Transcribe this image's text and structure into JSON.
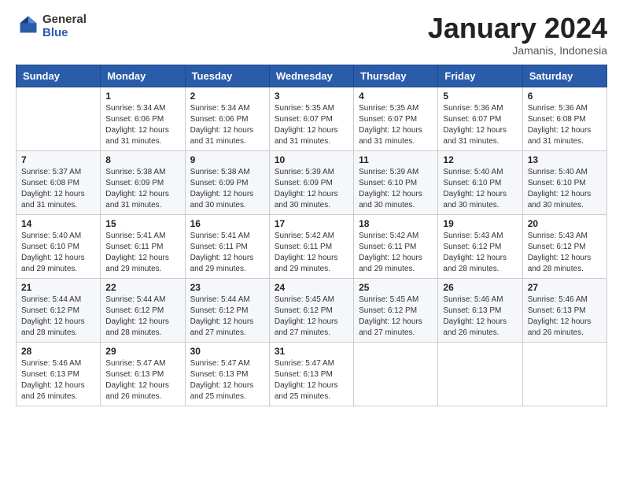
{
  "header": {
    "logo_general": "General",
    "logo_blue": "Blue",
    "month_title": "January 2024",
    "subtitle": "Jamanis, Indonesia"
  },
  "weekdays": [
    "Sunday",
    "Monday",
    "Tuesday",
    "Wednesday",
    "Thursday",
    "Friday",
    "Saturday"
  ],
  "weeks": [
    [
      {
        "day": "",
        "sunrise": "",
        "sunset": "",
        "daylight": ""
      },
      {
        "day": "1",
        "sunrise": "Sunrise: 5:34 AM",
        "sunset": "Sunset: 6:06 PM",
        "daylight": "Daylight: 12 hours and 31 minutes."
      },
      {
        "day": "2",
        "sunrise": "Sunrise: 5:34 AM",
        "sunset": "Sunset: 6:06 PM",
        "daylight": "Daylight: 12 hours and 31 minutes."
      },
      {
        "day": "3",
        "sunrise": "Sunrise: 5:35 AM",
        "sunset": "Sunset: 6:07 PM",
        "daylight": "Daylight: 12 hours and 31 minutes."
      },
      {
        "day": "4",
        "sunrise": "Sunrise: 5:35 AM",
        "sunset": "Sunset: 6:07 PM",
        "daylight": "Daylight: 12 hours and 31 minutes."
      },
      {
        "day": "5",
        "sunrise": "Sunrise: 5:36 AM",
        "sunset": "Sunset: 6:07 PM",
        "daylight": "Daylight: 12 hours and 31 minutes."
      },
      {
        "day": "6",
        "sunrise": "Sunrise: 5:36 AM",
        "sunset": "Sunset: 6:08 PM",
        "daylight": "Daylight: 12 hours and 31 minutes."
      }
    ],
    [
      {
        "day": "7",
        "sunrise": "Sunrise: 5:37 AM",
        "sunset": "Sunset: 6:08 PM",
        "daylight": "Daylight: 12 hours and 31 minutes."
      },
      {
        "day": "8",
        "sunrise": "Sunrise: 5:38 AM",
        "sunset": "Sunset: 6:09 PM",
        "daylight": "Daylight: 12 hours and 31 minutes."
      },
      {
        "day": "9",
        "sunrise": "Sunrise: 5:38 AM",
        "sunset": "Sunset: 6:09 PM",
        "daylight": "Daylight: 12 hours and 30 minutes."
      },
      {
        "day": "10",
        "sunrise": "Sunrise: 5:39 AM",
        "sunset": "Sunset: 6:09 PM",
        "daylight": "Daylight: 12 hours and 30 minutes."
      },
      {
        "day": "11",
        "sunrise": "Sunrise: 5:39 AM",
        "sunset": "Sunset: 6:10 PM",
        "daylight": "Daylight: 12 hours and 30 minutes."
      },
      {
        "day": "12",
        "sunrise": "Sunrise: 5:40 AM",
        "sunset": "Sunset: 6:10 PM",
        "daylight": "Daylight: 12 hours and 30 minutes."
      },
      {
        "day": "13",
        "sunrise": "Sunrise: 5:40 AM",
        "sunset": "Sunset: 6:10 PM",
        "daylight": "Daylight: 12 hours and 30 minutes."
      }
    ],
    [
      {
        "day": "14",
        "sunrise": "Sunrise: 5:40 AM",
        "sunset": "Sunset: 6:10 PM",
        "daylight": "Daylight: 12 hours and 29 minutes."
      },
      {
        "day": "15",
        "sunrise": "Sunrise: 5:41 AM",
        "sunset": "Sunset: 6:11 PM",
        "daylight": "Daylight: 12 hours and 29 minutes."
      },
      {
        "day": "16",
        "sunrise": "Sunrise: 5:41 AM",
        "sunset": "Sunset: 6:11 PM",
        "daylight": "Daylight: 12 hours and 29 minutes."
      },
      {
        "day": "17",
        "sunrise": "Sunrise: 5:42 AM",
        "sunset": "Sunset: 6:11 PM",
        "daylight": "Daylight: 12 hours and 29 minutes."
      },
      {
        "day": "18",
        "sunrise": "Sunrise: 5:42 AM",
        "sunset": "Sunset: 6:11 PM",
        "daylight": "Daylight: 12 hours and 29 minutes."
      },
      {
        "day": "19",
        "sunrise": "Sunrise: 5:43 AM",
        "sunset": "Sunset: 6:12 PM",
        "daylight": "Daylight: 12 hours and 28 minutes."
      },
      {
        "day": "20",
        "sunrise": "Sunrise: 5:43 AM",
        "sunset": "Sunset: 6:12 PM",
        "daylight": "Daylight: 12 hours and 28 minutes."
      }
    ],
    [
      {
        "day": "21",
        "sunrise": "Sunrise: 5:44 AM",
        "sunset": "Sunset: 6:12 PM",
        "daylight": "Daylight: 12 hours and 28 minutes."
      },
      {
        "day": "22",
        "sunrise": "Sunrise: 5:44 AM",
        "sunset": "Sunset: 6:12 PM",
        "daylight": "Daylight: 12 hours and 28 minutes."
      },
      {
        "day": "23",
        "sunrise": "Sunrise: 5:44 AM",
        "sunset": "Sunset: 6:12 PM",
        "daylight": "Daylight: 12 hours and 27 minutes."
      },
      {
        "day": "24",
        "sunrise": "Sunrise: 5:45 AM",
        "sunset": "Sunset: 6:12 PM",
        "daylight": "Daylight: 12 hours and 27 minutes."
      },
      {
        "day": "25",
        "sunrise": "Sunrise: 5:45 AM",
        "sunset": "Sunset: 6:12 PM",
        "daylight": "Daylight: 12 hours and 27 minutes."
      },
      {
        "day": "26",
        "sunrise": "Sunrise: 5:46 AM",
        "sunset": "Sunset: 6:13 PM",
        "daylight": "Daylight: 12 hours and 26 minutes."
      },
      {
        "day": "27",
        "sunrise": "Sunrise: 5:46 AM",
        "sunset": "Sunset: 6:13 PM",
        "daylight": "Daylight: 12 hours and 26 minutes."
      }
    ],
    [
      {
        "day": "28",
        "sunrise": "Sunrise: 5:46 AM",
        "sunset": "Sunset: 6:13 PM",
        "daylight": "Daylight: 12 hours and 26 minutes."
      },
      {
        "day": "29",
        "sunrise": "Sunrise: 5:47 AM",
        "sunset": "Sunset: 6:13 PM",
        "daylight": "Daylight: 12 hours and 26 minutes."
      },
      {
        "day": "30",
        "sunrise": "Sunrise: 5:47 AM",
        "sunset": "Sunset: 6:13 PM",
        "daylight": "Daylight: 12 hours and 25 minutes."
      },
      {
        "day": "31",
        "sunrise": "Sunrise: 5:47 AM",
        "sunset": "Sunset: 6:13 PM",
        "daylight": "Daylight: 12 hours and 25 minutes."
      },
      {
        "day": "",
        "sunrise": "",
        "sunset": "",
        "daylight": ""
      },
      {
        "day": "",
        "sunrise": "",
        "sunset": "",
        "daylight": ""
      },
      {
        "day": "",
        "sunrise": "",
        "sunset": "",
        "daylight": ""
      }
    ]
  ]
}
